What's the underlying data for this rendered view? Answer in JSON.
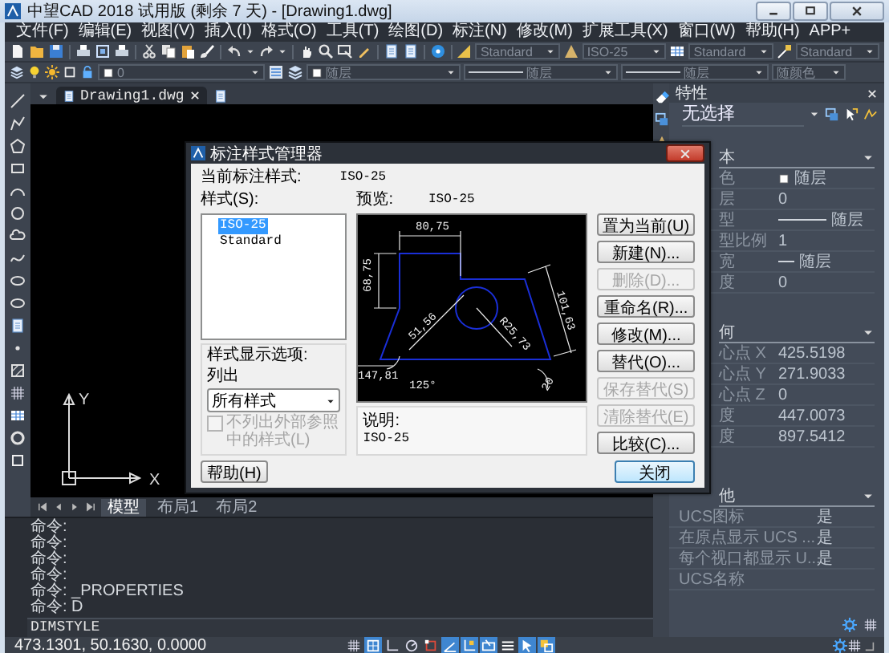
{
  "window": {
    "title": "中望CAD 2018 试用版 (剩余 7 天) - [Drawing1.dwg]"
  },
  "menu": [
    "文件(F)",
    "编辑(E)",
    "视图(V)",
    "插入(I)",
    "格式(O)",
    "工具(T)",
    "绘图(D)",
    "标注(N)",
    "修改(M)",
    "扩展工具(X)",
    "窗口(W)",
    "帮助(H)",
    "APP+"
  ],
  "toolbar": {
    "text_style": "Standard",
    "dim_style": "ISO-25",
    "table_style": "Standard",
    "mleader_style": "Standard",
    "layer": "0",
    "layer_color": "随层",
    "linetype": "随层",
    "lineweight": "随层",
    "plot_style": "随颜色"
  },
  "document_tab": {
    "title": "Drawing1.dwg"
  },
  "drawing": {
    "ucs_x": "X",
    "ucs_y": "Y"
  },
  "layout_tabs": [
    {
      "label": "模型",
      "selected": true
    },
    {
      "label": "布局1",
      "selected": false
    },
    {
      "label": "布局2",
      "selected": false
    }
  ],
  "command": {
    "history": [
      "命令:",
      "命令:",
      "命令:",
      "命令:",
      "命令: _PROPERTIES",
      "命令: D"
    ],
    "input": "DIMSTYLE"
  },
  "status_bar": {
    "coordinates": "473.1301, 50.1630, 0.0000",
    "toggles": [
      {
        "kind": "grid",
        "on": false
      },
      {
        "kind": "snap",
        "on": true
      },
      {
        "kind": "ortho",
        "on": false
      },
      {
        "kind": "polar",
        "on": false
      },
      {
        "kind": "osnap",
        "on": false
      },
      {
        "kind": "otrack",
        "on": true
      },
      {
        "kind": "ducs",
        "on": true
      },
      {
        "kind": "dyn",
        "on": true
      },
      {
        "kind": "lwt",
        "on": false
      },
      {
        "kind": "qp",
        "on": true
      },
      {
        "kind": "sc",
        "on": true
      }
    ]
  },
  "properties": {
    "title": "特性",
    "selection": "无选择",
    "sections": [
      {
        "title": "本",
        "rows": [
          {
            "label": "色",
            "value": "随层",
            "kind": "color"
          },
          {
            "label": "层",
            "value": "0",
            "kind": "text"
          },
          {
            "label": "型",
            "value": "随层",
            "kind": "linetype"
          },
          {
            "label": "型比例",
            "value": "1",
            "kind": "text"
          },
          {
            "label": "宽",
            "value": "随层",
            "kind": "lineweight"
          },
          {
            "label": "度",
            "value": "0",
            "kind": "text"
          }
        ]
      },
      {
        "title": "何",
        "rows": [
          {
            "label": "心点 X",
            "value": "425.5198",
            "kind": "text"
          },
          {
            "label": "心点 Y",
            "value": "271.9033",
            "kind": "text"
          },
          {
            "label": "心点 Z",
            "value": "0",
            "kind": "text"
          },
          {
            "label": "度",
            "value": "447.0073",
            "kind": "text"
          },
          {
            "label": "度",
            "value": "897.5412",
            "kind": "text"
          }
        ]
      },
      {
        "title": "他",
        "rows": [
          {
            "label": "UCS图标",
            "value": "是",
            "kind": "text"
          },
          {
            "label": "在原点显示 UCS ...",
            "value": "是",
            "kind": "text"
          },
          {
            "label": "每个视口都显示 U...",
            "value": "是",
            "kind": "text"
          },
          {
            "label": "UCS名称",
            "kind": "text"
          }
        ]
      }
    ]
  },
  "dialog": {
    "title": "标注样式管理器",
    "current_label": "当前标注样式:",
    "current_value": "ISO-25",
    "styles_label": "样式(S):",
    "styles": [
      {
        "name": "ISO-25",
        "selected": true
      },
      {
        "name": "Standard",
        "selected": false
      }
    ],
    "preview_label": "预览:",
    "preview_style": "ISO-25",
    "preview_dims": [
      "80,75",
      "68,75",
      "101,63",
      "R25,73",
      "51,56",
      "147,81",
      "125°",
      "20"
    ],
    "display_options_label": "样式显示选项:",
    "list_label": "列出",
    "list_value": "所有样式",
    "exclude_xref": {
      "label": "不列出外部参照中的样式(L)",
      "checked": false,
      "disabled": true
    },
    "description_label": "说明:",
    "description": "ISO-25",
    "buttons": [
      {
        "label": "置为当前(U)",
        "disabled": false
      },
      {
        "label": "新建(N)...",
        "disabled": false
      },
      {
        "label": "删除(D)...",
        "disabled": true
      },
      {
        "label": "重命名(R)...",
        "disabled": false
      },
      {
        "label": "修改(M)...",
        "disabled": false
      },
      {
        "label": "替代(O)...",
        "disabled": false
      },
      {
        "label": "保存替代(S)",
        "disabled": true
      },
      {
        "label": "清除替代(E)",
        "disabled": true
      },
      {
        "label": "比较(C)...",
        "disabled": false
      }
    ],
    "help": "帮助(H)",
    "close": "关闭"
  }
}
